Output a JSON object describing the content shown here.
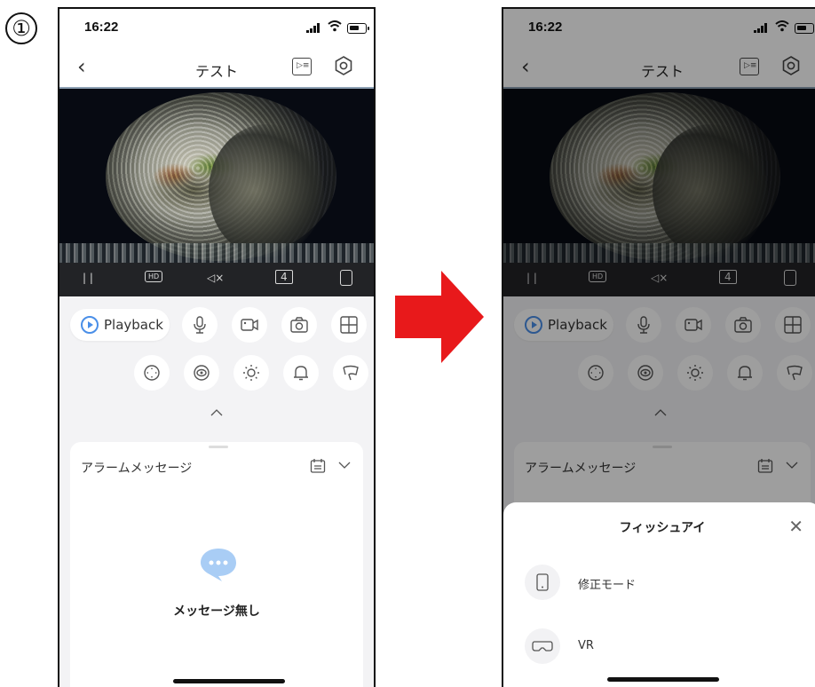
{
  "step": "①",
  "screens": [
    {
      "status_time": "16:22",
      "nav_title": "テスト",
      "playback_label": "Playback",
      "ctrl_hd": "HD",
      "ctrl_split": "4",
      "alarm_title": "アラームメッセージ",
      "empty_message": "メッセージ無し"
    },
    {
      "status_time": "16:22",
      "nav_title": "テスト",
      "playback_label": "Playback",
      "ctrl_hd": "HD",
      "ctrl_split": "4",
      "alarm_title": "アラームメッセージ",
      "modal_title": "フィッシュアイ",
      "options": [
        {
          "label": "修正モード",
          "icon": "phone-icon"
        },
        {
          "label": "VR",
          "icon": "vr-headset-icon"
        }
      ]
    }
  ],
  "colors": {
    "arrow": "#e8191b",
    "accent": "#4a8fe8",
    "bubble": "#a9cdf5"
  }
}
